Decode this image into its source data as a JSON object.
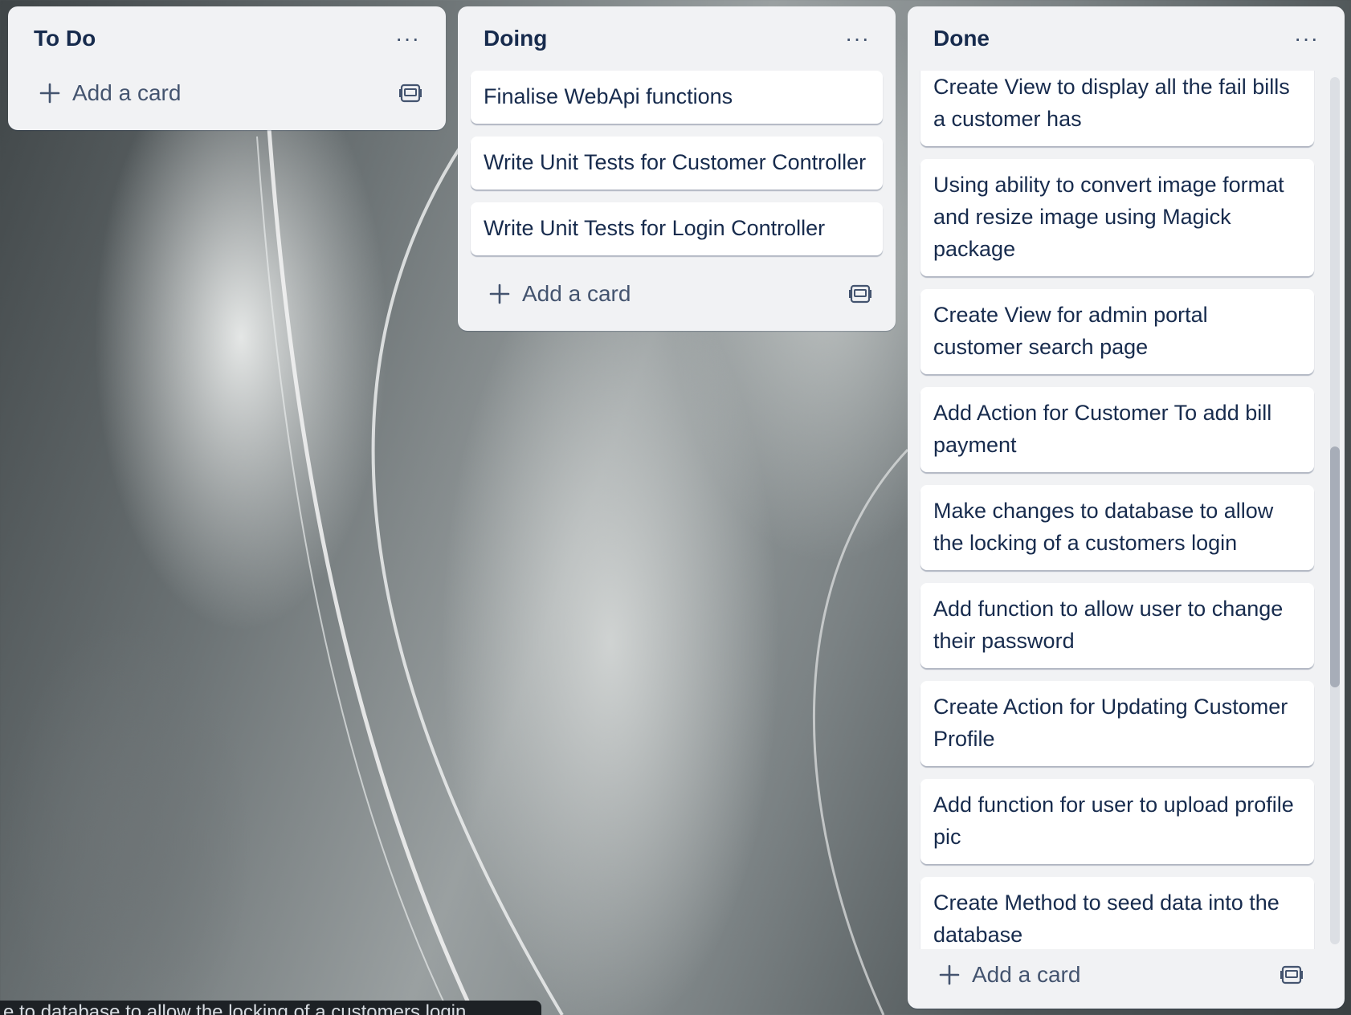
{
  "board": {
    "lists": [
      {
        "title": "To Do",
        "menu_label": "···",
        "add_card_label": "Add a card",
        "cards": []
      },
      {
        "title": "Doing",
        "menu_label": "···",
        "add_card_label": "Add a card",
        "cards": [
          "Finalise WebApi functions",
          "Write Unit Tests for Customer Controller",
          "Write Unit Tests for Login Controller"
        ]
      },
      {
        "title": "Done",
        "menu_label": "···",
        "add_card_label": "Add a card",
        "cards": [
          "Create View to display all the fail bills a customer has",
          "Using ability to convert image format and resize image using Magick package",
          "Create View for admin portal customer search page",
          "Add Action for Customer To add bill payment",
          "Make changes to database to allow the locking of a customers login",
          "Add function to allow user to change their password",
          "Create Action for Updating Customer Profile",
          "Add function for user to upload profile pic",
          "Create Method to seed data into the database"
        ]
      }
    ]
  },
  "status_tooltip": "e to database to allow the locking of a customers login",
  "icons": {
    "menu": "more-horizontal-icon",
    "add": "plus-icon",
    "template": "card-template-icon"
  },
  "colors": {
    "list_bg": "#f1f2f4",
    "card_bg": "#ffffff",
    "text": "#172b4d",
    "muted": "#44546f"
  }
}
